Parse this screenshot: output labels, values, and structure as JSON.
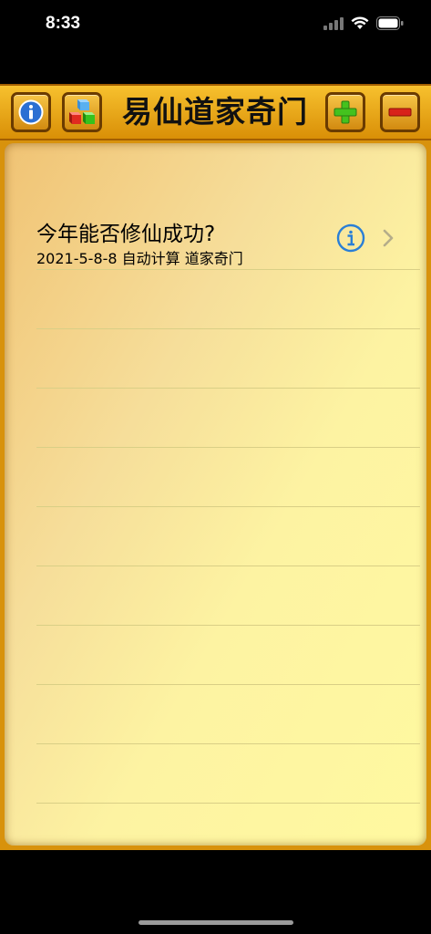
{
  "status_bar": {
    "time": "8:33"
  },
  "toolbar": {
    "title": "易仙道家奇门"
  },
  "list": {
    "items": [
      {
        "title": "今年能否修仙成功?",
        "subtitle": "2021-5-8-8  自动计算 道家奇门"
      }
    ]
  },
  "icons": {
    "info": "info-icon",
    "cubes": "cubes-icon",
    "add": "plus-icon",
    "remove": "minus-icon",
    "detail": "info-circle-icon",
    "disclosure": "chevron-right-icon"
  },
  "colors": {
    "toolbar": "#e9a819",
    "pad_light": "#fff9a0",
    "pad_dark": "#f0c374",
    "info_blue": "#2a7fd6",
    "add_green": "#3fb81f",
    "remove_red": "#d0221a"
  }
}
